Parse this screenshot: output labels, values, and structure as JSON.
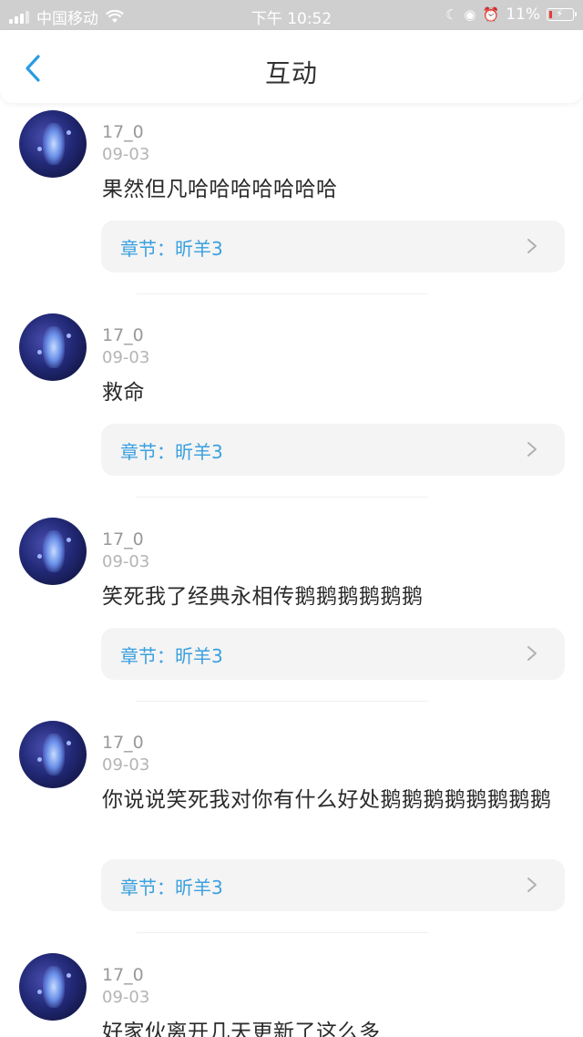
{
  "status_bar": {
    "carrier": "中国移动",
    "time": "下午 10:52",
    "battery": "11%"
  },
  "nav": {
    "title": "互动"
  },
  "comments": [
    {
      "user": "17_0",
      "date": "09-03",
      "text": "果然但凡哈哈哈哈哈哈哈",
      "chapter": "章节：昕羊3"
    },
    {
      "user": "17_0",
      "date": "09-03",
      "text": "救命",
      "chapter": "章节：昕羊3"
    },
    {
      "user": "17_0",
      "date": "09-03",
      "text": "笑死我了经典永相传鹅鹅鹅鹅鹅鹅",
      "chapter": "章节：昕羊3"
    },
    {
      "user": "17_0",
      "date": "09-03",
      "text": "你说说笑死我对你有什么好处鹅鹅鹅鹅鹅鹅鹅鹅",
      "chapter": "章节：昕羊3"
    },
    {
      "user": "17_0",
      "date": "09-03",
      "text": "好家伙离开几天更新了这么多"
    }
  ],
  "colors": {
    "accent": "#3aa0e0",
    "card_bg": "#f4f4f4"
  }
}
